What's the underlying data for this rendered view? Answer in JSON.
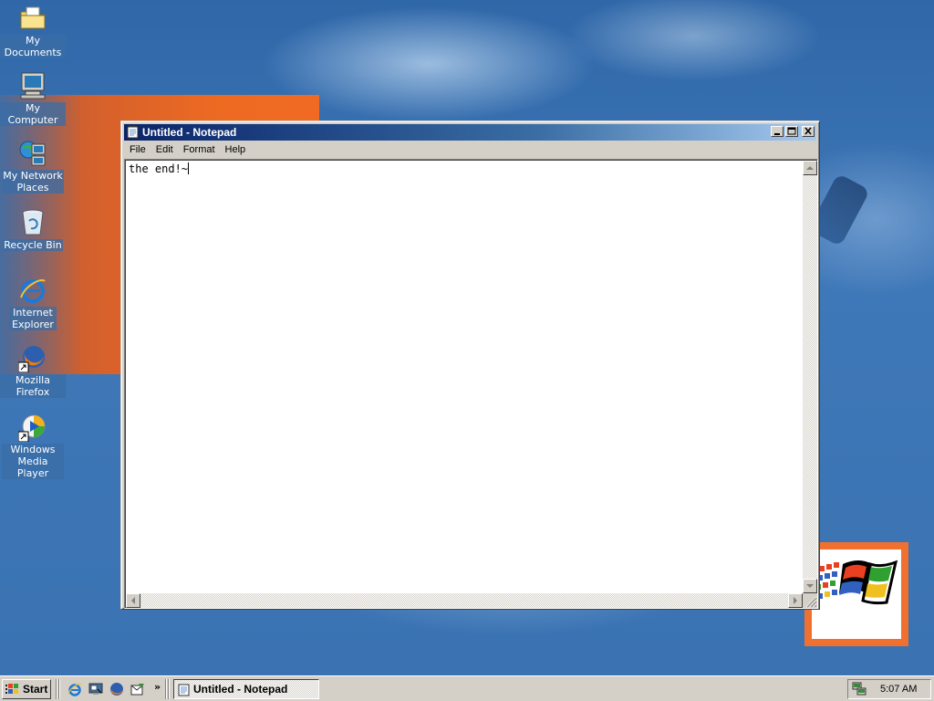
{
  "desktop": {
    "icons": [
      {
        "label": "My Documents",
        "icon": "folder-documents-icon"
      },
      {
        "label": "My Computer",
        "icon": "computer-icon"
      },
      {
        "label": "My Network Places",
        "icon": "network-icon"
      },
      {
        "label": "Recycle Bin",
        "icon": "recycle-bin-icon"
      },
      {
        "label": "Internet Explorer",
        "icon": "internet-explorer-icon"
      },
      {
        "label": "Mozilla Firefox",
        "icon": "firefox-icon"
      },
      {
        "label": "Windows Media Player",
        "icon": "media-player-icon"
      }
    ]
  },
  "notepad": {
    "title": "Untitled - Notepad",
    "menu": [
      "File",
      "Edit",
      "Format",
      "Help"
    ],
    "content": "the end!~",
    "controls": {
      "minimize": "_",
      "maximize": "□",
      "close": "×"
    }
  },
  "taskbar": {
    "start_label": "Start",
    "quick_launch": [
      "internet-explorer-icon",
      "show-desktop-icon",
      "firefox-icon",
      "outlook-express-icon"
    ],
    "chevron": "»",
    "active_task": "Untitled - Notepad",
    "clock": "5:07 AM"
  },
  "colors": {
    "desktop": "#3a6ea5",
    "title_active_start": "#0a246a",
    "title_active_end": "#a6caf0",
    "face": "#d4d0c8"
  }
}
